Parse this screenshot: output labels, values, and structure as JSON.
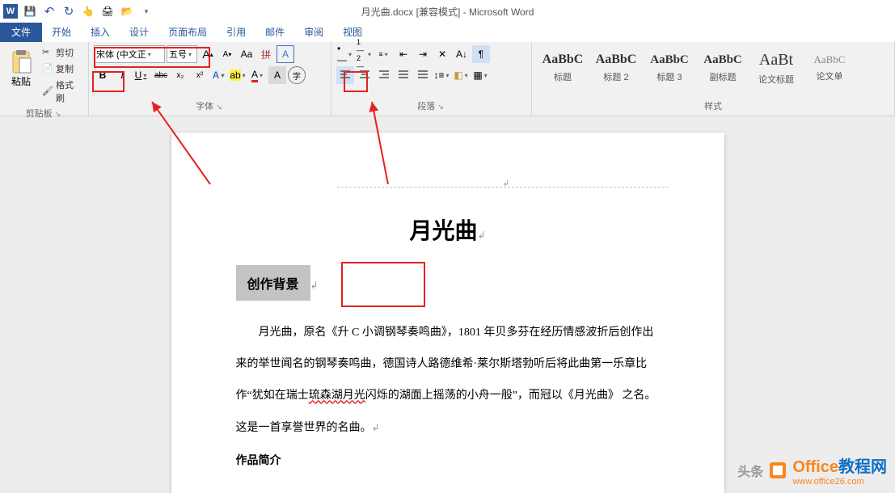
{
  "title": "月光曲.docx [兼容模式] - Microsoft Word",
  "qat": {
    "word_icon": "W",
    "save": "💾",
    "undo": "↶",
    "redo": "↻",
    "touch": "👆",
    "preview": "🖨",
    "open": "📂",
    "drop": "▾"
  },
  "tabs": {
    "file": "文件",
    "home": "开始",
    "insert": "插入",
    "design": "设计",
    "layout": "页面布局",
    "references": "引用",
    "mailings": "邮件",
    "review": "审阅",
    "view": "视图"
  },
  "clipboard": {
    "paste": "粘贴",
    "cut": "剪切",
    "copy": "复制",
    "format_painter": "格式刷",
    "group": "剪贴板"
  },
  "font": {
    "name": "宋体 (中文正",
    "size": "五号",
    "group": "字体",
    "bold": "B",
    "italic": "I",
    "underline": "U",
    "strike": "abc",
    "sub": "x₂",
    "sup": "x²",
    "grow": "A",
    "shrink": "A",
    "case": "Aa",
    "clear": "A",
    "phonetic": "拼",
    "char_border": "A",
    "font_color": "A",
    "highlight": "ab",
    "enclose": "字",
    "effect": "A"
  },
  "paragraph": {
    "group": "段落",
    "bullets": "•",
    "numbering": "1.",
    "multilevel": "≡",
    "dec_indent": "⇤",
    "inc_indent": "⇥",
    "sort": "A↓",
    "show_marks": "¶",
    "align_left": "≡",
    "center": "≡",
    "align_right": "≡",
    "justify": "≡",
    "dist": "≡",
    "line_spacing": "↕",
    "shading": "▢",
    "borders": "▢"
  },
  "styles": {
    "group": "样式",
    "items": [
      {
        "preview": "AaBbC",
        "label": "标题"
      },
      {
        "preview": "AaBbC",
        "label": "标题 2"
      },
      {
        "preview": "AaBbC",
        "label": "标题 3"
      },
      {
        "preview": "AaBbC",
        "label": "副标题"
      },
      {
        "preview": "AaBt",
        "label": "论文标题"
      },
      {
        "preview": "AaBbC",
        "label": "论文单"
      }
    ]
  },
  "doc": {
    "title": "月光曲",
    "heading1": "创作背景",
    "para1": "月光曲，原名《升 C 小调钢琴奏鸣曲》，1801 年贝多芬在经历情感波折后创作出来的举世闻名的钢琴奏鸣曲，德国诗人路德维希·莱尔斯塔勃听后将此曲第一乐章比作“犹如在瑞士",
    "para1_squiggle": "琉森湖月光",
    "para1_rest": "闪烁的湖面上摇荡的小舟一般”，而冠以《月光曲》 之名。这是一首享誉世界的名曲。",
    "heading2": "作品简介",
    "page_mark": "↲",
    "title_mark": "↲",
    "heading_mark": "↲",
    "para_mark": "↲"
  },
  "watermark": {
    "brand1": "Office",
    "brand2": "教程网",
    "url": "www.office26.com",
    "extra": "头条"
  }
}
